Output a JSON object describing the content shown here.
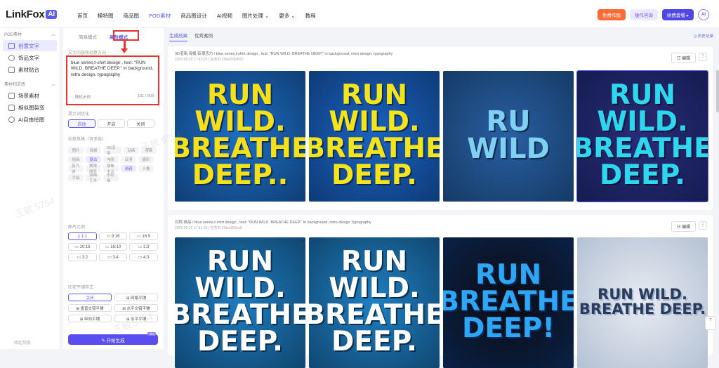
{
  "topbar": {
    "logo": "LinkFox",
    "logo_badge": "AI",
    "nav": [
      "首页",
      "模特图",
      "商品图",
      "POD素材",
      "商品图设计",
      "AI视频",
      "图片处理 ⌄",
      "更多 ⌄",
      "教程"
    ],
    "active_nav": 3,
    "btn_free": "免费作图",
    "btn_consult": "操作咨询",
    "btn_vip": "续费套餐 ▸",
    "avatar": "AI"
  },
  "leftnav": {
    "section1": "POD素材",
    "section1_items": [
      "创意文字",
      "饰品文字",
      "素材贴合"
    ],
    "section2": "素材和灵感",
    "section2_items": [
      "场景素材",
      "相似图裂变",
      "AI自由绘图"
    ],
    "footer": "收起导航"
  },
  "panel": {
    "tab_simple": "简易模式",
    "tab_advanced": "高阶模式",
    "prompt_label": "文字内容和创意方向",
    "prompt_text": "blue series,t-shirt design , text: \"RUN WILD. BREATHE DEEP.\" in background, retro design, typography",
    "prompt_random": "◌ 随机示例",
    "prompt_count": "101 / 600",
    "optimize_label": "提示词优化",
    "optimize_opts": [
      "自动",
      "开启",
      "关闭"
    ],
    "style_label": "创意风格（可多选）",
    "styles": [
      "图片",
      "海报",
      "3D渲染",
      "动画",
      "漫画",
      "插画",
      "复古",
      "电影",
      "日漫",
      "摄影",
      "蒸汽波",
      "赛博朋克",
      "抽象主义",
      "涂鸦",
      "人像",
      "手绘",
      "油画艺术",
      "水彩画"
    ],
    "style_selected": [
      "复古",
      "涂鸦"
    ],
    "ratio_label": "图片比例",
    "ratios": [
      "▯ 1:1",
      "▭ 9:16",
      "▭ 16:9",
      "▭ 10:16",
      "▭ 16:10",
      "▭ 2:3",
      "▭ 3:2",
      "▭ 3:4",
      "▭ 4:3"
    ],
    "tile_label": "印花平铺样式",
    "tiles": [
      "关闭",
      "⊞ 网格平铺",
      "⊞ 垂直交错平铺",
      "⊞ 水平交错平铺",
      "⊞ 纵向平铺",
      "⊞ 水平平铺"
    ],
    "gen_button": "✎ 开始生成",
    "gen_badge": "402"
  },
  "main": {
    "tabs": [
      "生成结果",
      "优秀案例"
    ],
    "history": "◷ 历史记录",
    "edit_label": "☷ 编辑",
    "more_label": "⋮",
    "cards": [
      {
        "title": "3D渲染,海报,街潮活力  /  blue series,t-shirt design , text: \"RUN WILD. BREATHE DEEP.\" in background, retro design, typography",
        "meta": "2025-05-22 17:40:25 | 任务ID:29ba2f2b4f29",
        "images": [
          {
            "lines": [
              "RUN",
              "WILD.",
              "BREATHE",
              "DEEP.."
            ],
            "bg": "#1c6fc4",
            "fg": "#f5e11b",
            "shadow": "#0b2a55"
          },
          {
            "lines": [
              "RUN",
              "WILD.",
              "BREATHE",
              "DEEP."
            ],
            "bg": "#1a63c0",
            "fg": "#f2e41d",
            "shadow": "#0a2a5a"
          },
          {
            "lines": [
              "RU",
              "WILD"
            ],
            "bg": "#2a5fa2",
            "fg": "#7fd0f2",
            "shadow": "#0c2c4e"
          },
          {
            "lines": [
              "RUN",
              "WILD.",
              "BREATHE",
              "DEEP."
            ],
            "bg": "#2a2c78",
            "fg": "#2fd7ee",
            "shadow": "#0b1640"
          }
        ]
      },
      {
        "title": "对称,商品  /  blue series,t-shirt design , text: \"RUN WILD. BREATHE DEEP.\" in background, retro design, typography",
        "meta": "2025-05-22 17:41:18 | 任务ID:29bbd3f3ec8",
        "images": [
          {
            "lines": [
              "RUN",
              "WILD.",
              "BREATHE",
              "DEEP."
            ],
            "bg": "#1e7cbe",
            "fg": "#ffffff",
            "shadow": "#0a3050"
          },
          {
            "lines": [
              "RUN",
              "WILD.",
              "BREATHE",
              "DEEP."
            ],
            "bg": "#1f80c2",
            "fg": "#ffffff",
            "shadow": "#0a3050"
          },
          {
            "lines": [
              "RUN",
              "BREATHE",
              "DEEP!"
            ],
            "bg": "#0b0b12",
            "fg": "#2ea6f4",
            "shadow": "#0a2a5c"
          },
          {
            "lines": [
              "RUN WILD.",
              "BREATHE DEEP."
            ],
            "bg": "#e8ecf2",
            "fg": "#2a3c5e",
            "shadow": "#9fb0c8"
          }
        ]
      }
    ]
  },
  "watermarks": [
    "王敏 5754",
    "王敏 5754",
    "王敏 5754"
  ],
  "colors": {
    "accent": "#5b5cf0",
    "highlight": "#e8322d",
    "orange": "#ff6b35"
  }
}
